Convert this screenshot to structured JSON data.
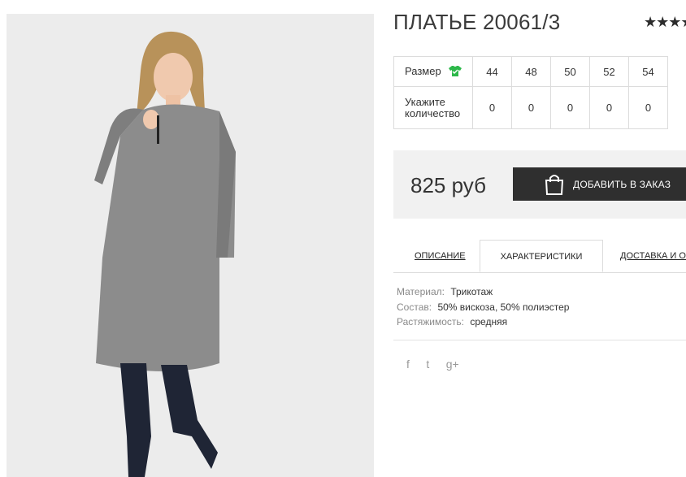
{
  "product": {
    "title": "ПЛАТЬЕ 20061/3",
    "rating_stars": "★★★★",
    "price": "825 руб"
  },
  "size_table": {
    "size_label": "Размер",
    "qty_label": "Укажите количество",
    "sizes": [
      "44",
      "48",
      "50",
      "52",
      "54"
    ],
    "quantities": [
      "0",
      "0",
      "0",
      "0",
      "0"
    ]
  },
  "cart": {
    "add_label": "ДОБАВИТЬ В ЗАКАЗ"
  },
  "tabs": {
    "description": "ОПИСАНИЕ",
    "characteristics": "ХАРАКТЕРИСТИКИ",
    "delivery": "ДОСТАВКА И ОП"
  },
  "specs": {
    "material_key": "Материал:",
    "material_val": "Трикотаж",
    "composition_key": "Состав:",
    "composition_val": "50% вискоза, 50% полиэстер",
    "stretch_key": "Растяжимость:",
    "stretch_val": "средняя"
  },
  "social": {
    "facebook": "f",
    "twitter": "t",
    "googleplus": "g+"
  },
  "colors": {
    "button": "#2f2f2f",
    "price_box": "#f1f1f1",
    "size_icon": "#2db84a"
  }
}
